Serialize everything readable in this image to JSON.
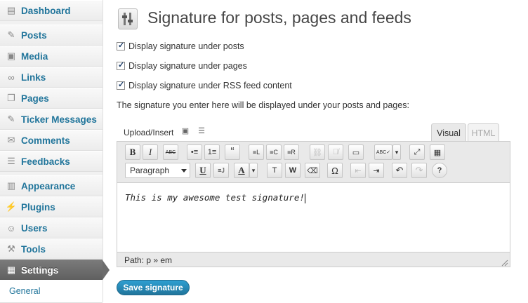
{
  "sidebar": {
    "items": [
      {
        "label": "Dashboard",
        "icon": "dashboard-icon"
      },
      {
        "label": "Posts",
        "icon": "pushpin-icon"
      },
      {
        "label": "Media",
        "icon": "media-icon"
      },
      {
        "label": "Links",
        "icon": "link-icon"
      },
      {
        "label": "Pages",
        "icon": "pages-icon"
      },
      {
        "label": "Ticker Messages",
        "icon": "pushpin-icon"
      },
      {
        "label": "Comments",
        "icon": "comment-bubble-icon"
      },
      {
        "label": "Feedbacks",
        "icon": "feedback-icon"
      },
      {
        "label": "Appearance",
        "icon": "appearance-icon"
      },
      {
        "label": "Plugins",
        "icon": "plug-icon"
      },
      {
        "label": "Users",
        "icon": "users-icon"
      },
      {
        "label": "Tools",
        "icon": "tools-icon"
      },
      {
        "label": "Settings",
        "icon": "settings-icon"
      }
    ],
    "active": "Settings",
    "submenu": {
      "label": "General"
    }
  },
  "page": {
    "title": "Signature for posts, pages and feeds",
    "checkboxes": [
      {
        "label": "Display signature under posts",
        "checked": true
      },
      {
        "label": "Display signature under pages",
        "checked": true
      },
      {
        "label": "Display signature under RSS feed content",
        "checked": true
      }
    ],
    "description": "The signature you enter here will be displayed under your posts and pages:"
  },
  "editor": {
    "upload_label": "Upload/Insert",
    "tabs": {
      "visual": "Visual",
      "html": "HTML"
    },
    "active_tab": "Visual",
    "format_select": "Paragraph",
    "toolbar_row1": [
      "B",
      "I",
      "ABC",
      "•≡",
      "1≡",
      "“",
      "≡L",
      "≡C",
      "≡R",
      "⛓",
      "⛓̸",
      "▭",
      "ABC✓",
      "▾",
      "⤢",
      "▦"
    ],
    "toolbar_row2": [
      "U",
      "≡J",
      "A",
      "▾",
      "T",
      "W",
      "⌫",
      "Ω",
      "⇤",
      "⇥",
      "↶",
      "↷",
      "?"
    ],
    "content": "This is my awesome test signature!",
    "path": "Path: p » em"
  },
  "save_button": "Save signature",
  "colors": {
    "link": "#21759b",
    "active_menu": "#6d6d6d",
    "save_button": "#21759b"
  }
}
